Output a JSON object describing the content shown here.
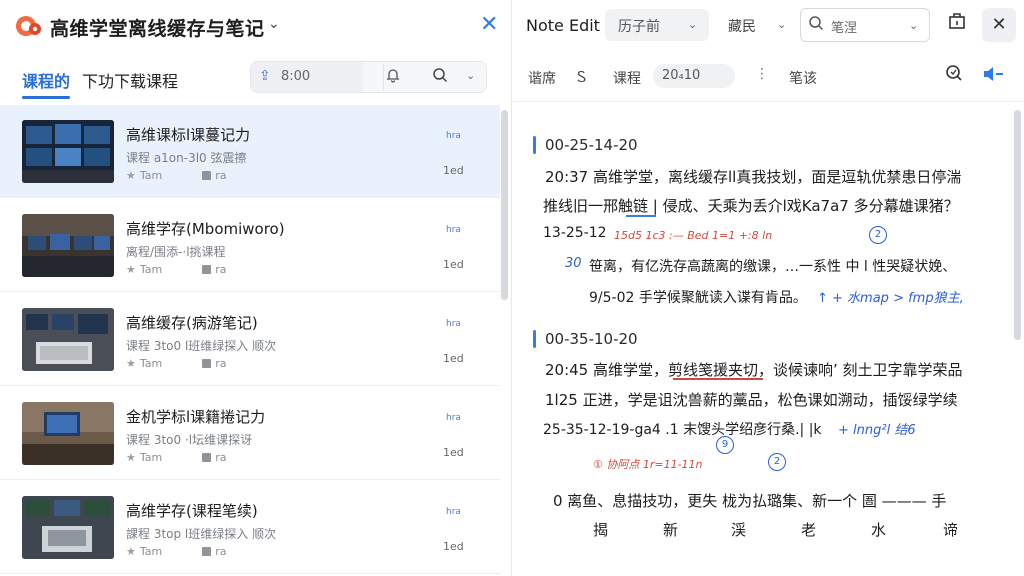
{
  "left_panel": {
    "title": "高维学堂离线缓存与笔记",
    "tabs": {
      "active": "课程的",
      "second": "下功下载课程"
    },
    "toolbar": {
      "time": "8:00"
    },
    "courses": [
      {
        "title": "高维课标l课蔓记力",
        "subtitle": "课程 a1on-3l0 弦震擦",
        "meta1": "Tam",
        "meta2": "ra",
        "badge": "hra",
        "duration": "1ed"
      },
      {
        "title": "高维学存(Mbomiworo)",
        "subtitle": "离程/围添-·l挑课程",
        "meta1": "Tam",
        "meta2": "ra",
        "badge": "hra",
        "duration": "1ed"
      },
      {
        "title": "高维缓存(病游笔记)",
        "subtitle": "课程 3to0 l班维绿探入 顺次",
        "meta1": "Tam",
        "meta2": "ra",
        "badge": "hra",
        "duration": "1ed"
      },
      {
        "title": "金机学标l课籍捲记力",
        "subtitle": "课程 3to0 ·l坛维课探讶",
        "meta1": "Tam",
        "meta2": "ra",
        "badge": "hra",
        "duration": "1ed"
      },
      {
        "title": "高维学存(课程笔续)",
        "subtitle": "課程 3top l班维绿探入 顺次",
        "meta1": "Tam",
        "meta2": "ra",
        "badge": "hra",
        "duration": "1ed"
      }
    ]
  },
  "right_panel": {
    "title": "Note Edit",
    "select1": "历子前",
    "select2": "藏民",
    "search_placeholder": "笔涅",
    "toolbar": {
      "item1": "谐席",
      "item2": "课程",
      "pill": "20₄10",
      "item3": "笔该"
    },
    "sections": [
      {
        "timestamp": "00-25-14-20",
        "lines": [
          "20:37  高维学堂，离线缓存ll真我技划，面是逗轨优禁患日停湍",
          "推线旧一邢触链 | 侵成、夭乘为丢介l戏Ka7a7 多分幕雄课猪？"
        ],
        "time_line": "13-25-12",
        "red_note": "15d5 1c3 :— Bed  1=1 +:8 ln",
        "circle1": "2",
        "blue_lead": "30",
        "line3": "笹离，有亿洗存高蔬离的缴课，…一系性 中 l 性哭疑状娩、",
        "line4_prefix": "9/5-02  手学候聚觥读入谍有肯品。",
        "blue_tail": "↑ + 水map > fmp狼主,"
      },
      {
        "timestamp": "00-35-10-20",
        "line1": "20:45  高维学堂，剪线笺援夹切，谈候谏响’ 刻土卫字靠学荣品",
        "line2": "1l25  正进，学是诅沈兽薪的藁品，松色课如溯动，插馁绿学续",
        "line3_prefix": "25-35-12-19-ga4 .1 末馊头学绍彦行桑.| |k",
        "blue_tail": "+ lnng²l 结6",
        "circle2": "9",
        "red_note": "① 协阿点  1r=11-11n",
        "circle3": "2",
        "line4": "0     离鱼、息描技功，更失 栊为払璐集、新一个 圄 ——— 手",
        "line5": [
          "揭",
          "新",
          "渓",
          "老",
          "水",
          "谛"
        ]
      }
    ]
  }
}
